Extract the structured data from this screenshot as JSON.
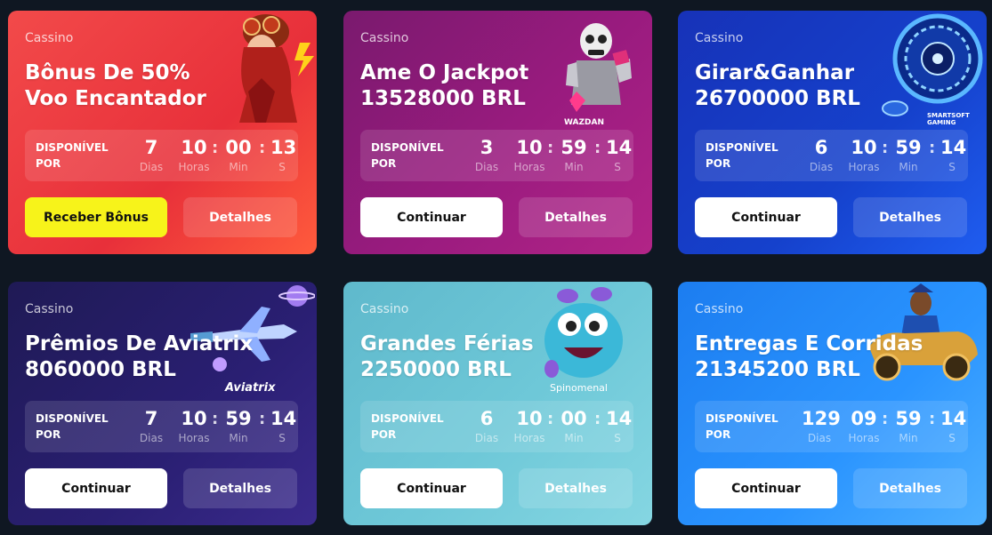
{
  "timer_labels": {
    "available": "DISPONÍVEL POR",
    "days": "Dias",
    "hours": "Horas",
    "minutes": "Min",
    "seconds": "S"
  },
  "cards": [
    {
      "category": "Cassino",
      "title_line1": "Bônus De 50%",
      "title_line2": "Voo Encantador",
      "timer": {
        "d": "7",
        "h": "10",
        "m": "00",
        "s": "13"
      },
      "primary_label": "Receber Bônus",
      "secondary_label": "Detalhes",
      "accent": "#f7f31a"
    },
    {
      "category": "Cassino",
      "title_line1": "Ame O Jackpot",
      "title_line2": "13528000 BRL",
      "timer": {
        "d": "3",
        "h": "10",
        "m": "59",
        "s": "14"
      },
      "primary_label": "Continuar",
      "secondary_label": "Detalhes",
      "brand": "WAZDAN"
    },
    {
      "category": "Cassino",
      "title_line1": "Girar&Ganhar",
      "title_line2": "26700000 BRL",
      "timer": {
        "d": "6",
        "h": "10",
        "m": "59",
        "s": "14"
      },
      "primary_label": "Continuar",
      "secondary_label": "Detalhes",
      "brand": "SMARTSOFT GAMING"
    },
    {
      "category": "Cassino",
      "title_line1": "Prêmios De Aviatrix",
      "title_line2": "8060000 BRL",
      "timer": {
        "d": "7",
        "h": "10",
        "m": "59",
        "s": "14"
      },
      "primary_label": "Continuar",
      "secondary_label": "Detalhes",
      "brand": "Aviatrix"
    },
    {
      "category": "Cassino",
      "title_line1": "Grandes Férias",
      "title_line2": "2250000 BRL",
      "timer": {
        "d": "6",
        "h": "10",
        "m": "00",
        "s": "14"
      },
      "primary_label": "Continuar",
      "secondary_label": "Detalhes",
      "brand": "Spinomenal"
    },
    {
      "category": "Cassino",
      "title_line1": "Entregas E Corridas",
      "title_line2": "21345200 BRL",
      "timer": {
        "d": "129",
        "h": "09",
        "m": "59",
        "s": "14"
      },
      "primary_label": "Continuar",
      "secondary_label": "Detalhes"
    }
  ]
}
